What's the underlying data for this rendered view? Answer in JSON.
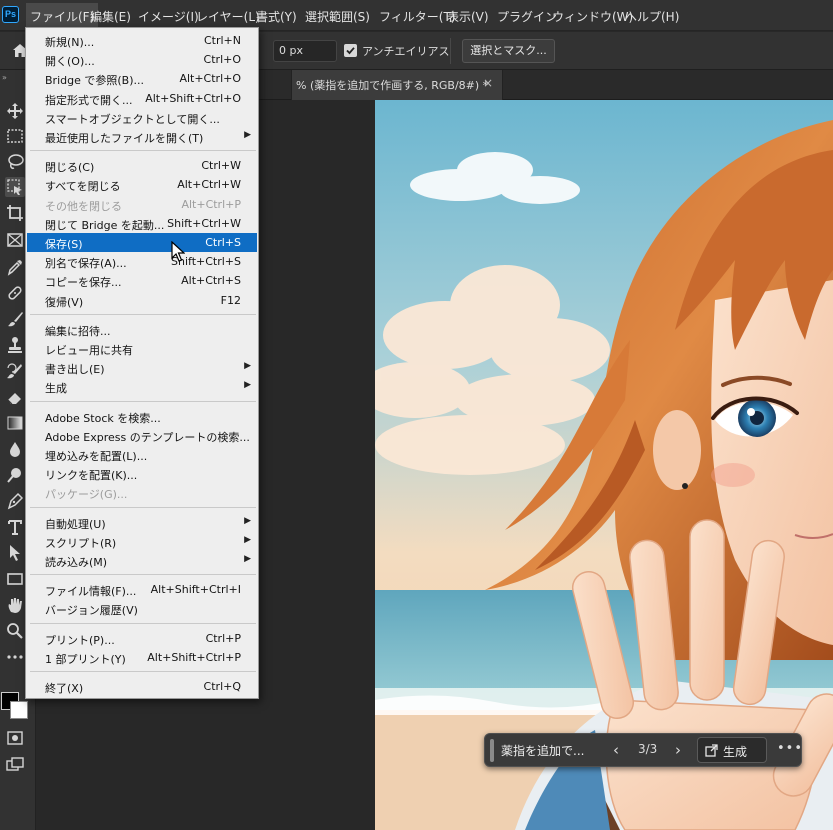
{
  "app": {
    "logo": "Ps"
  },
  "menubar": {
    "items": [
      "ファイル(F)",
      "編集(E)",
      "イメージ(I)",
      "レイヤー(L)",
      "書式(Y)",
      "選択範囲(S)",
      "フィルター(T)",
      "表示(V)",
      "プラグイン",
      "ウィンドウ(W)",
      "ヘルプ(H)"
    ]
  },
  "options": {
    "feather_value": "0 px",
    "antialias_label": "アンチエイリアス",
    "antialias_checked": true,
    "select_mask_label": "選択とマスク..."
  },
  "document": {
    "tab_title": "% (薬指を追加で作画する, RGB/8#) *",
    "close_glyph": "×"
  },
  "file_menu": {
    "groups": [
      [
        {
          "label": "新規(N)...",
          "shortcut": "Ctrl+N"
        },
        {
          "label": "開く(O)...",
          "shortcut": "Ctrl+O"
        },
        {
          "label": "Bridge で参照(B)...",
          "shortcut": "Alt+Ctrl+O"
        },
        {
          "label": "指定形式で開く...",
          "shortcut": "Alt+Shift+Ctrl+O"
        },
        {
          "label": "スマートオブジェクトとして開く...",
          "shortcut": ""
        },
        {
          "label": "最近使用したファイルを開く(T)",
          "shortcut": "",
          "submenu": true
        }
      ],
      [
        {
          "label": "閉じる(C)",
          "shortcut": "Ctrl+W"
        },
        {
          "label": "すべてを閉じる",
          "shortcut": "Alt+Ctrl+W"
        },
        {
          "label": "その他を閉じる",
          "shortcut": "Alt+Ctrl+P",
          "disabled": true
        },
        {
          "label": "閉じて Bridge を起動...",
          "shortcut": "Shift+Ctrl+W"
        },
        {
          "label": "保存(S)",
          "shortcut": "Ctrl+S",
          "highlight": true
        },
        {
          "label": "別名で保存(A)...",
          "shortcut": "Shift+Ctrl+S"
        },
        {
          "label": "コピーを保存...",
          "shortcut": "Alt+Ctrl+S"
        },
        {
          "label": "復帰(V)",
          "shortcut": "F12"
        }
      ],
      [
        {
          "label": "編集に招待...",
          "shortcut": ""
        },
        {
          "label": "レビュー用に共有",
          "shortcut": ""
        },
        {
          "label": "書き出し(E)",
          "shortcut": "",
          "submenu": true
        },
        {
          "label": "生成",
          "shortcut": "",
          "submenu": true
        }
      ],
      [
        {
          "label": "Adobe Stock を検索...",
          "shortcut": ""
        },
        {
          "label": "Adobe Express のテンプレートの検索...",
          "shortcut": ""
        },
        {
          "label": "埋め込みを配置(L)...",
          "shortcut": ""
        },
        {
          "label": "リンクを配置(K)...",
          "shortcut": ""
        },
        {
          "label": "パッケージ(G)...",
          "shortcut": "",
          "disabled": true
        }
      ],
      [
        {
          "label": "自動処理(U)",
          "shortcut": "",
          "submenu": true
        },
        {
          "label": "スクリプト(R)",
          "shortcut": "",
          "submenu": true
        },
        {
          "label": "読み込み(M)",
          "shortcut": "",
          "submenu": true
        }
      ],
      [
        {
          "label": "ファイル情報(F)...",
          "shortcut": "Alt+Shift+Ctrl+I"
        },
        {
          "label": "バージョン履歴(V)",
          "shortcut": ""
        }
      ],
      [
        {
          "label": "プリント(P)...",
          "shortcut": "Ctrl+P"
        },
        {
          "label": "1 部プリント(Y)",
          "shortcut": "Alt+Shift+Ctrl+P"
        }
      ],
      [
        {
          "label": "終了(X)",
          "shortcut": "Ctrl+Q"
        }
      ]
    ],
    "submenu_glyph": "▶"
  },
  "taskbar": {
    "prompt": "薬指を追加で...",
    "prev_glyph": "‹",
    "count": "3/3",
    "next_glyph": "›",
    "generate_label": "生成",
    "more_glyph": "•••"
  },
  "tools": [
    "move-tool-icon",
    "marquee-tool-icon",
    "lasso-tool-icon",
    "object-select-tool-icon",
    "crop-tool-icon",
    "frame-tool-icon",
    "eyedropper-tool-icon",
    "healing-brush-tool-icon",
    "brush-tool-icon",
    "clone-stamp-tool-icon",
    "history-brush-tool-icon",
    "eraser-tool-icon",
    "gradient-tool-icon",
    "blur-tool-icon",
    "dodge-tool-icon",
    "pen-tool-icon",
    "type-tool-icon",
    "path-select-tool-icon",
    "rectangle-tool-icon",
    "hand-tool-icon",
    "zoom-tool-icon",
    "more-tools-icon"
  ],
  "colors": {
    "menu_highlight": "#0f6dc4",
    "ui_dark": "#323232",
    "menu_bg": "#eeeeee",
    "foreground": "#000000",
    "background": "#ffffff"
  }
}
